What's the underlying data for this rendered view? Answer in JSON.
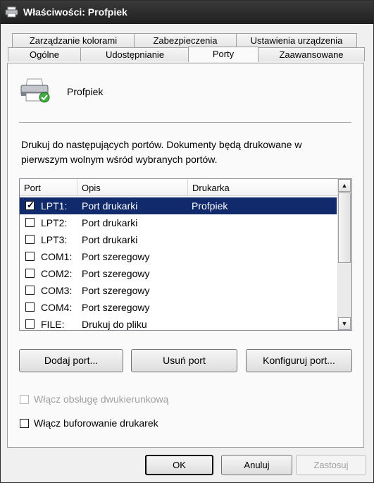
{
  "window": {
    "title": "Właściwości: Profpiek"
  },
  "tabs": {
    "row1": [
      {
        "label": "Zarządzanie kolorami"
      },
      {
        "label": "Zabezpieczenia"
      },
      {
        "label": "Ustawienia urządzenia"
      }
    ],
    "row2": [
      {
        "label": "Ogólne"
      },
      {
        "label": "Udostępnianie"
      },
      {
        "label": "Porty",
        "active": true
      },
      {
        "label": "Zaawansowane"
      }
    ]
  },
  "printer": {
    "name": "Profpiek",
    "icon": "printer-icon"
  },
  "description": "Drukuj do następujących portów. Dokumenty będą drukowane w pierwszym wolnym wśród wybranych portów.",
  "ports_table": {
    "columns": [
      "Port",
      "Opis",
      "Drukarka"
    ],
    "rows": [
      {
        "port": "LPT1:",
        "desc": "Port drukarki",
        "printer": "Profpiek",
        "checked": true,
        "selected": true
      },
      {
        "port": "LPT2:",
        "desc": "Port drukarki",
        "printer": "",
        "checked": false
      },
      {
        "port": "LPT3:",
        "desc": "Port drukarki",
        "printer": "",
        "checked": false
      },
      {
        "port": "COM1:",
        "desc": "Port szeregowy",
        "printer": "",
        "checked": false
      },
      {
        "port": "COM2:",
        "desc": "Port szeregowy",
        "printer": "",
        "checked": false
      },
      {
        "port": "COM3:",
        "desc": "Port szeregowy",
        "printer": "",
        "checked": false
      },
      {
        "port": "COM4:",
        "desc": "Port szeregowy",
        "printer": "",
        "checked": false
      },
      {
        "port": "FILE:",
        "desc": "Drukuj do pliku",
        "printer": "",
        "checked": false
      }
    ]
  },
  "port_buttons": {
    "add": "Dodaj port...",
    "remove": "Usuń port",
    "configure": "Konfiguruj port..."
  },
  "options": {
    "bidirectional": {
      "label": "Włącz obsługę dwukierunkową",
      "checked": false,
      "enabled": false
    },
    "pooling": {
      "label": "Włącz buforowanie drukarek",
      "checked": false,
      "enabled": true
    }
  },
  "dialog_buttons": {
    "ok": "OK",
    "cancel": "Anuluj",
    "apply": "Zastosuj"
  },
  "colors": {
    "selection": "#112a6b",
    "titlebar": "#2a2a2a",
    "face": "#f0f0f0"
  }
}
